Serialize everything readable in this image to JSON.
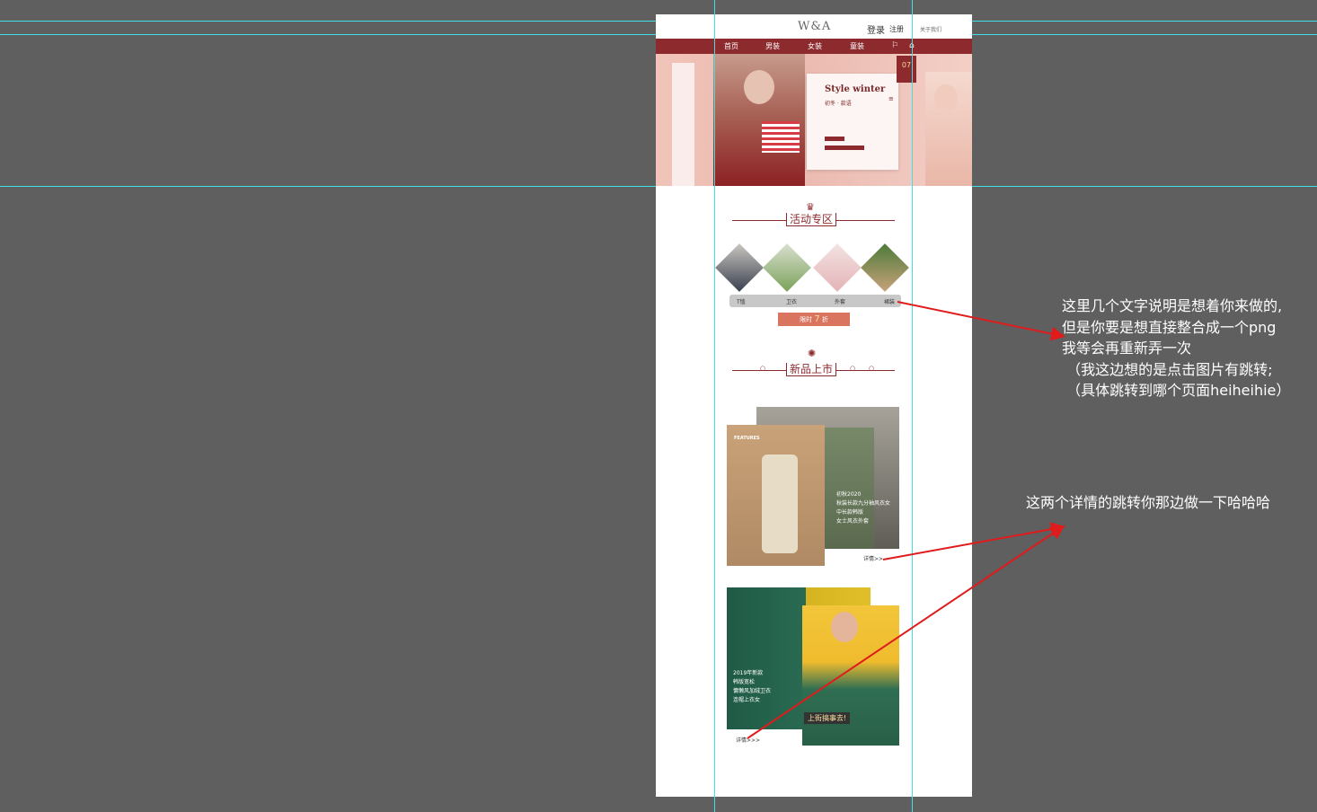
{
  "header": {
    "logo": "W&A",
    "login": "登录",
    "register": "注册",
    "about": "关于我们"
  },
  "nav": {
    "items": [
      "首页",
      "男装",
      "女装",
      "童装"
    ],
    "bg_color": "#8c2a2e"
  },
  "banner": {
    "title": "Style winter",
    "subtitle": "初冬 · 款语",
    "date": "07"
  },
  "activity": {
    "title": "活动专区",
    "categories": [
      "T恤",
      "卫衣",
      "外套",
      "裙装"
    ],
    "promo_prefix": "限时",
    "promo_number": "7",
    "promo_suffix": "折"
  },
  "new_arrivals": {
    "title": "新品上市",
    "product1": {
      "features": "FEATURES",
      "lines": [
        "初秋2020",
        "秋装长款九分袖风衣女",
        "中长款韩版",
        "女士风衣外套"
      ],
      "detail": "详情>>"
    },
    "product2": {
      "lines": [
        "2019年新款",
        "韩版宽松",
        "慵懒风加绒卫衣",
        "连帽上衣女"
      ],
      "badge": "上街搞事去!",
      "detail": "详情>>>"
    }
  },
  "annotations": {
    "note1": "这里几个文字说明是想着你来做的,\n但是你要是想直接整合成一个png\n我等会再重新弄一次\n （我这边想的是点击图片有跳转;\n （具体跳转到哪个页面heiheihie）",
    "note2": "这两个详情的跳转你那边做一下哈哈哈"
  },
  "colors": {
    "canvas": "#5f5f5f",
    "guide": "#3fe0e8",
    "arrow": "#e01b1b",
    "accent": "#8c2a2e"
  }
}
